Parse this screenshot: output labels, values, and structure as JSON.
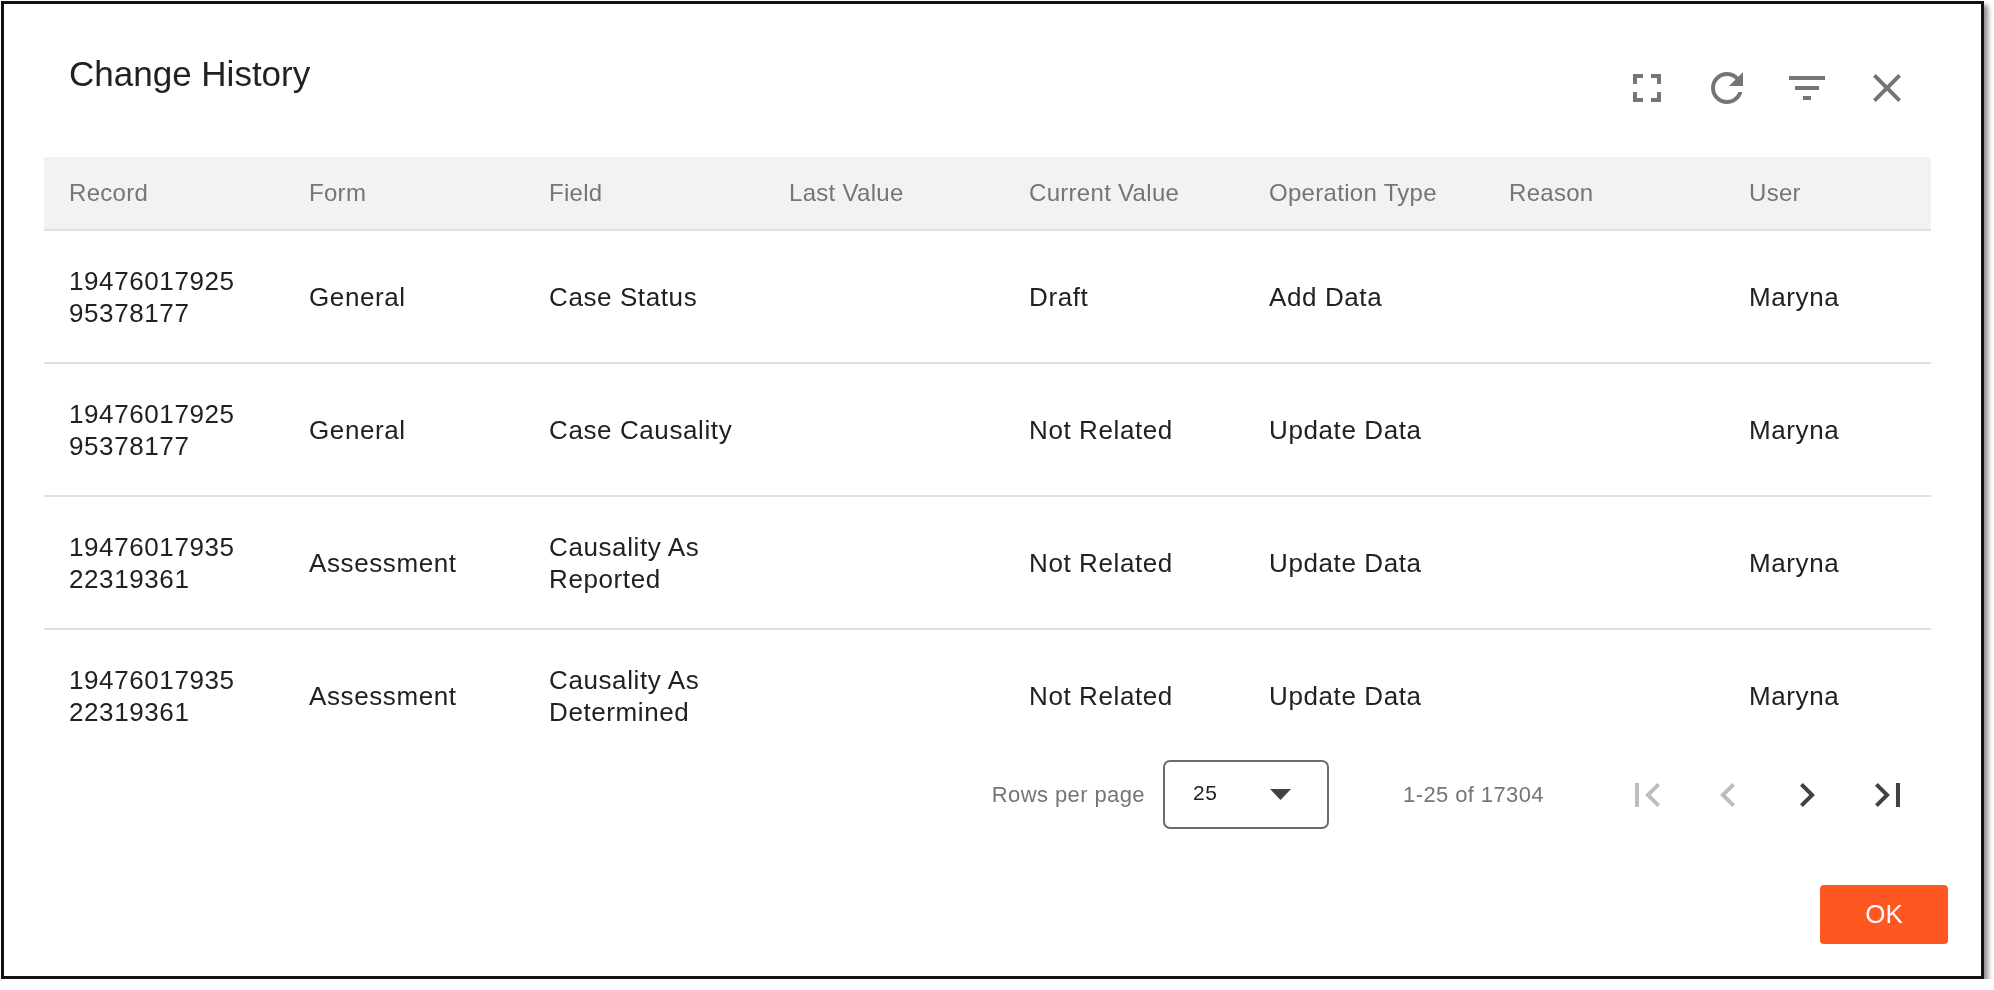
{
  "dialog": {
    "title": "Change History"
  },
  "table": {
    "columns": [
      "Record",
      "Form",
      "Field",
      "Last Value",
      "Current Value",
      "Operation Type",
      "Reason",
      "User"
    ],
    "rows": [
      {
        "record": "1947601792595378177",
        "form": "General",
        "field": "Case Status",
        "current_value": "Draft",
        "operation_type": "Add Data",
        "user": "Maryna"
      },
      {
        "record": "1947601792595378177",
        "form": "General",
        "field": "Case Causality",
        "current_value": "Not Related",
        "operation_type": "Update Data",
        "user": "Maryna"
      },
      {
        "record": "1947601793522319361",
        "form": "Assessment",
        "field": "Causality As Reported",
        "current_value": "Not Related",
        "operation_type": "Update Data",
        "user": "Maryna"
      },
      {
        "record": "1947601793522319361",
        "form": "Assessment",
        "field": "Causality As Determined",
        "current_value": "Not Related",
        "operation_type": "Update Data",
        "user": "Maryna"
      }
    ]
  },
  "pagination": {
    "rows_per_page_label": "Rows per page",
    "rows_per_page": "25",
    "range": "1-25 of 17304",
    "buttons": [
      {
        "kind": "first",
        "disabled": true
      },
      {
        "kind": "previous",
        "disabled": true
      },
      {
        "kind": "next",
        "disabled": false
      },
      {
        "kind": "last",
        "disabled": false
      }
    ]
  },
  "actions": [
    {
      "label": "OK"
    }
  ]
}
